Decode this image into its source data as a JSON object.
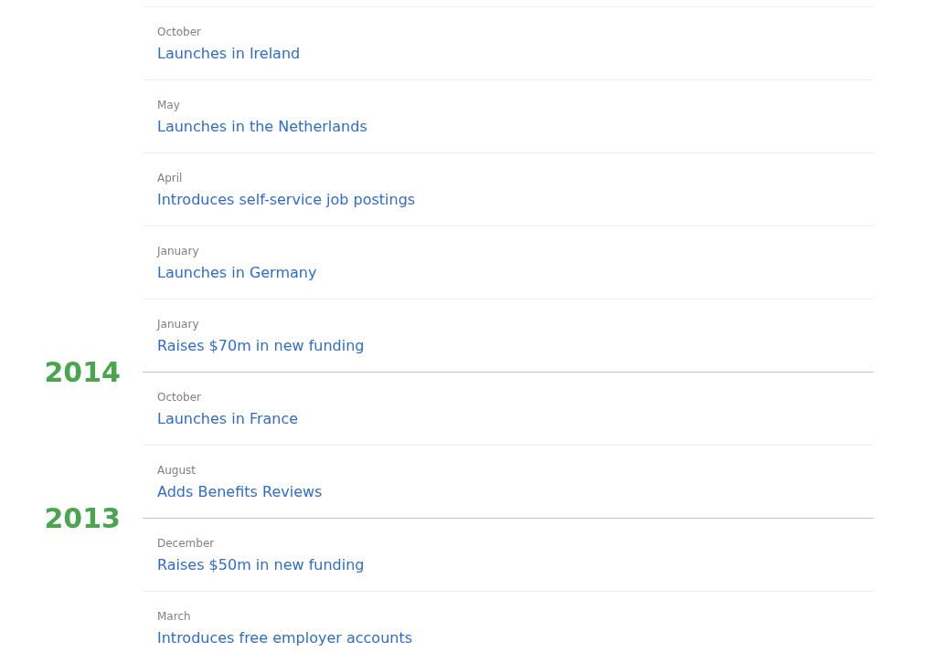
{
  "timeline": [
    {
      "year": "2014",
      "events": [
        {
          "month": "October",
          "title": "Launches in Ireland"
        },
        {
          "month": "May",
          "title": "Launches in the Netherlands"
        },
        {
          "month": "April",
          "title": "Introduces self-service job postings"
        },
        {
          "month": "January",
          "title": "Launches in Germany"
        },
        {
          "month": "January",
          "title": "Raises $70m in new funding"
        }
      ]
    },
    {
      "year": "2013",
      "events": [
        {
          "month": "October",
          "title": "Launches in France"
        },
        {
          "month": "August",
          "title": "Adds Benefits Reviews"
        }
      ]
    },
    {
      "events": [
        {
          "month": "December",
          "title": "Raises $50m in new funding"
        },
        {
          "month": "March",
          "title": "Introduces free employer accounts"
        }
      ]
    }
  ]
}
